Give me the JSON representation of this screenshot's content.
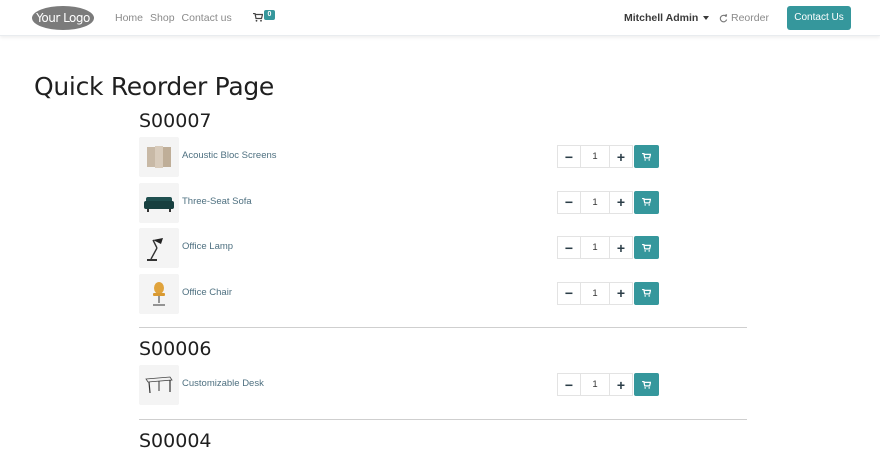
{
  "header": {
    "logo_text": "Your Logo",
    "nav": [
      {
        "label": "Home"
      },
      {
        "label": "Shop"
      },
      {
        "label": "Contact us"
      }
    ],
    "cart_count": "0",
    "user_name": "Mitchell Admin",
    "reorder_label": "Reorder",
    "contact_button": "Contact Us"
  },
  "page_title": "Quick Reorder Page",
  "orders": [
    {
      "name": "S00007",
      "lines": [
        {
          "product": "Acoustic Bloc Screens",
          "qty": "1",
          "icon": "screens-image"
        },
        {
          "product": "Three-Seat Sofa",
          "qty": "1",
          "icon": "sofa-image"
        },
        {
          "product": "Office Lamp",
          "qty": "1",
          "icon": "lamp-image"
        },
        {
          "product": "Office Chair",
          "qty": "1",
          "icon": "chair-image"
        }
      ]
    },
    {
      "name": "S00006",
      "lines": [
        {
          "product": "Customizable Desk",
          "qty": "1",
          "icon": "desk-image"
        }
      ]
    },
    {
      "name": "S00004",
      "lines": []
    }
  ],
  "colors": {
    "accent": "#35979c",
    "link": "#4e7080"
  }
}
